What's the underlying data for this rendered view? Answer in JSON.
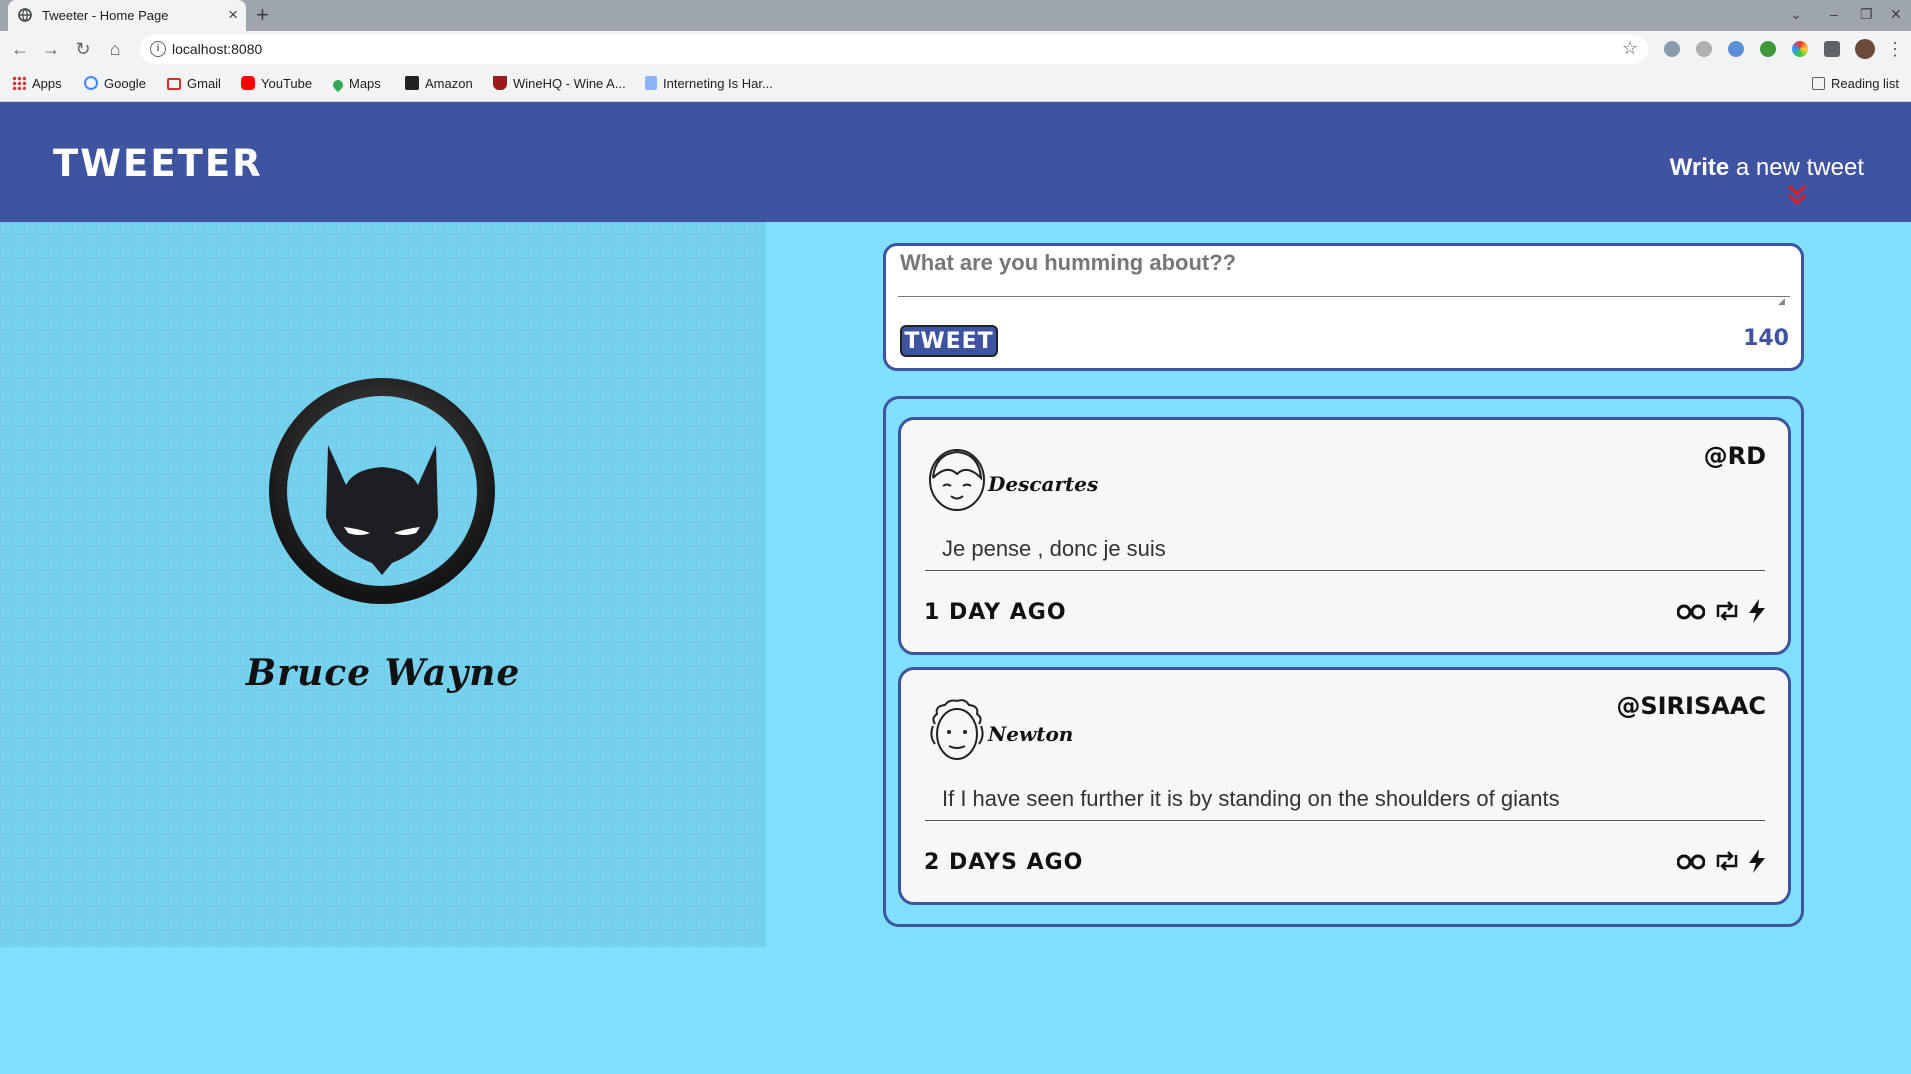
{
  "browser": {
    "tab_title": "Tweeter - Home Page",
    "new_tab": "+",
    "url": "localhost:8080",
    "bookmarks": [
      "Apps",
      "Google",
      "Gmail",
      "YouTube",
      "Maps",
      "Amazon",
      "WineHQ - Wine A...",
      "Interneting Is Har..."
    ],
    "reading_list": "Reading list"
  },
  "header": {
    "logo": "TWEETER",
    "compose_bold": "Write",
    "compose_rest": " a new tweet",
    "accent_color": "#3f54a0",
    "arrow_color": "#e11d2a"
  },
  "profile": {
    "name": "Bruce Wayne",
    "avatar_icon": "batman-mask-icon"
  },
  "composer": {
    "placeholder": "What are you humming about??",
    "value": "",
    "button_label": "TWEET",
    "char_counter": "140"
  },
  "tweets": [
    {
      "name": "Descartes",
      "handle": "@RD",
      "text": "Je pense , donc je suis",
      "time": "1 DAY AGO",
      "avatar_icon": "descartes-avatar-icon"
    },
    {
      "name": "Newton",
      "handle": "@SIRISAAC",
      "text": "If I have seen further it is by standing on the shoulders of giants",
      "time": "2 DAYS AGO",
      "avatar_icon": "newton-avatar-icon"
    }
  ]
}
